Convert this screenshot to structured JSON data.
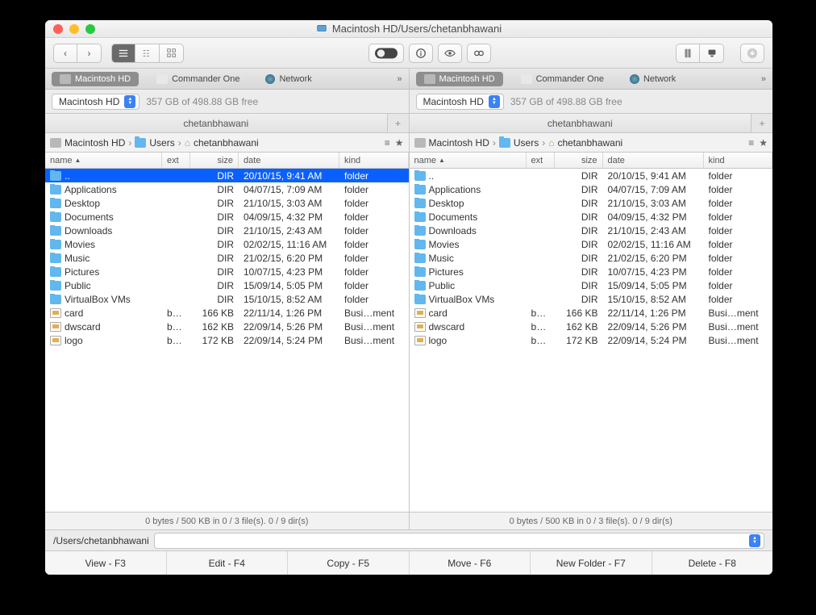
{
  "title": "Macintosh HD/Users/chetanbhawani",
  "tabs": {
    "macintosh": "Macintosh HD",
    "commander": "Commander One",
    "network": "Network"
  },
  "volume": {
    "name": "Macintosh HD",
    "freespace": "357 GB of 498.88 GB free"
  },
  "pane_tab": "chetanbhawani",
  "breadcrumb": {
    "root": "Macintosh HD",
    "users": "Users",
    "current": "chetanbhawani"
  },
  "columns": {
    "name": "name",
    "ext": "ext",
    "size": "size",
    "date": "date",
    "kind": "kind"
  },
  "files": [
    {
      "icon": "folder",
      "name": "..",
      "ext": "",
      "size": "DIR",
      "date": "20/10/15, 9:41 AM",
      "kind": "folder",
      "selected": true
    },
    {
      "icon": "folder",
      "name": "Applications",
      "ext": "",
      "size": "DIR",
      "date": "04/07/15, 7:09 AM",
      "kind": "folder"
    },
    {
      "icon": "folder",
      "name": "Desktop",
      "ext": "",
      "size": "DIR",
      "date": "21/10/15, 3:03 AM",
      "kind": "folder"
    },
    {
      "icon": "folder",
      "name": "Documents",
      "ext": "",
      "size": "DIR",
      "date": "04/09/15, 4:32 PM",
      "kind": "folder"
    },
    {
      "icon": "folder",
      "name": "Downloads",
      "ext": "",
      "size": "DIR",
      "date": "21/10/15, 2:43 AM",
      "kind": "folder"
    },
    {
      "icon": "folder",
      "name": "Movies",
      "ext": "",
      "size": "DIR",
      "date": "02/02/15, 11:16 AM",
      "kind": "folder"
    },
    {
      "icon": "folder",
      "name": "Music",
      "ext": "",
      "size": "DIR",
      "date": "21/02/15, 6:20 PM",
      "kind": "folder"
    },
    {
      "icon": "folder",
      "name": "Pictures",
      "ext": "",
      "size": "DIR",
      "date": "10/07/15, 4:23 PM",
      "kind": "folder"
    },
    {
      "icon": "folder",
      "name": "Public",
      "ext": "",
      "size": "DIR",
      "date": "15/09/14, 5:05 PM",
      "kind": "folder"
    },
    {
      "icon": "folder",
      "name": "VirtualBox VMs",
      "ext": "",
      "size": "DIR",
      "date": "15/10/15, 8:52 AM",
      "kind": "folder"
    },
    {
      "icon": "file",
      "name": "card",
      "ext": "bc…",
      "size": "166 KB",
      "date": "22/11/14, 1:26 PM",
      "kind": "Busi…ment"
    },
    {
      "icon": "file",
      "name": "dwscard",
      "ext": "bc…",
      "size": "162 KB",
      "date": "22/09/14, 5:26 PM",
      "kind": "Busi…ment"
    },
    {
      "icon": "file",
      "name": "logo",
      "ext": "bc…",
      "size": "172 KB",
      "date": "22/09/14, 5:24 PM",
      "kind": "Busi…ment"
    }
  ],
  "files_right": [
    {
      "icon": "folder",
      "name": "..",
      "ext": "",
      "size": "DIR",
      "date": "20/10/15, 9:41 AM",
      "kind": "folder"
    },
    {
      "icon": "folder",
      "name": "Applications",
      "ext": "",
      "size": "DIR",
      "date": "04/07/15, 7:09 AM",
      "kind": "folder"
    },
    {
      "icon": "folder",
      "name": "Desktop",
      "ext": "",
      "size": "DIR",
      "date": "21/10/15, 3:03 AM",
      "kind": "folder"
    },
    {
      "icon": "folder",
      "name": "Documents",
      "ext": "",
      "size": "DIR",
      "date": "04/09/15, 4:32 PM",
      "kind": "folder"
    },
    {
      "icon": "folder",
      "name": "Downloads",
      "ext": "",
      "size": "DIR",
      "date": "21/10/15, 2:43 AM",
      "kind": "folder"
    },
    {
      "icon": "folder",
      "name": "Movies",
      "ext": "",
      "size": "DIR",
      "date": "02/02/15, 11:16 AM",
      "kind": "folder"
    },
    {
      "icon": "folder",
      "name": "Music",
      "ext": "",
      "size": "DIR",
      "date": "21/02/15, 6:20 PM",
      "kind": "folder"
    },
    {
      "icon": "folder",
      "name": "Pictures",
      "ext": "",
      "size": "DIR",
      "date": "10/07/15, 4:23 PM",
      "kind": "folder"
    },
    {
      "icon": "folder",
      "name": "Public",
      "ext": "",
      "size": "DIR",
      "date": "15/09/14, 5:05 PM",
      "kind": "folder"
    },
    {
      "icon": "folder",
      "name": "VirtualBox VMs",
      "ext": "",
      "size": "DIR",
      "date": "15/10/15, 8:52 AM",
      "kind": "folder"
    },
    {
      "icon": "file",
      "name": "card",
      "ext": "bc…",
      "size": "166 KB",
      "date": "22/11/14, 1:26 PM",
      "kind": "Busi…ment"
    },
    {
      "icon": "file",
      "name": "dwscard",
      "ext": "bc…",
      "size": "162 KB",
      "date": "22/09/14, 5:26 PM",
      "kind": "Busi…ment"
    },
    {
      "icon": "file",
      "name": "logo",
      "ext": "bc…",
      "size": "172 KB",
      "date": "22/09/14, 5:24 PM",
      "kind": "Busi…ment"
    }
  ],
  "status": "0 bytes / 500 KB in 0 / 3 file(s). 0 / 9 dir(s)",
  "path_label": "/Users/chetanbhawani",
  "fkeys": {
    "view": "View - F3",
    "edit": "Edit - F4",
    "copy": "Copy - F5",
    "move": "Move - F6",
    "newfolder": "New Folder - F7",
    "delete": "Delete - F8"
  }
}
